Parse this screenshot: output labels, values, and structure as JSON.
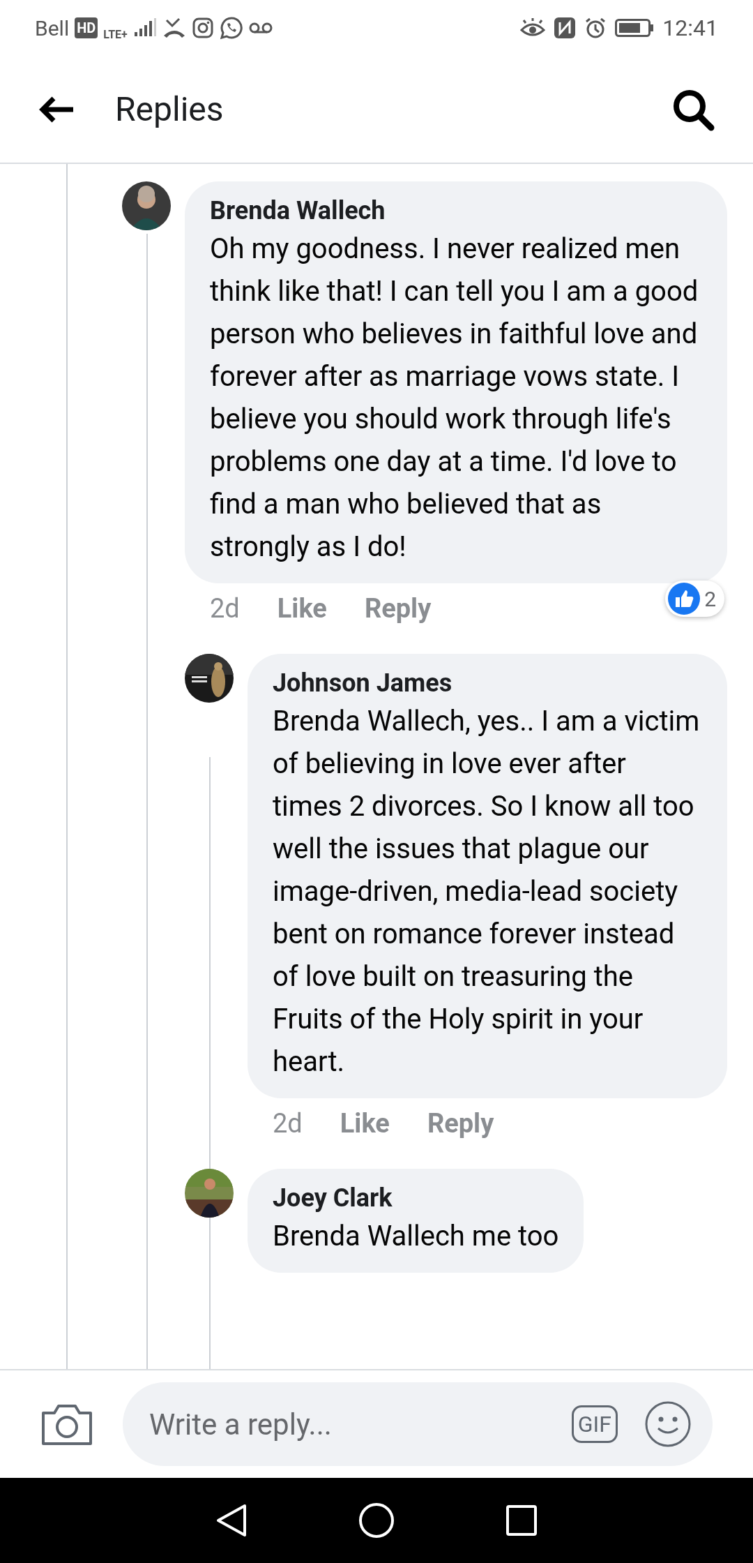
{
  "status_bar": {
    "carrier": "Bell",
    "hd": "HD",
    "network": "LTE+",
    "time": "12:41"
  },
  "header": {
    "title": "Replies"
  },
  "comments": [
    {
      "author": "Brenda Wallech",
      "text": "Oh my goodness. I never realized men think like that! I can tell you I am a good person who believes in faithful love and forever after as marriage vows state. I believe you should work through life's problems one day at a time. I'd love to find a man who believed that as strongly as I do!",
      "time": "2d",
      "actions": [
        "Like",
        "Reply"
      ],
      "reactions": {
        "count": "2"
      },
      "children": [
        {
          "author": "Johnson James",
          "text": "Brenda Wallech, yes.. I am a victim of believing in love ever after times 2 divorces. So I know all too well the issues that plague our image-driven, media-lead society bent on romance forever instead of love built on treasuring the Fruits of the Holy spirit in your heart.",
          "time": "2d",
          "actions": [
            "Like",
            "Reply"
          ]
        },
        {
          "author": "Joey Clark",
          "text": "Brenda Wallech me too"
        }
      ]
    }
  ],
  "composer": {
    "placeholder": "Write a reply...",
    "gif": "GIF"
  }
}
